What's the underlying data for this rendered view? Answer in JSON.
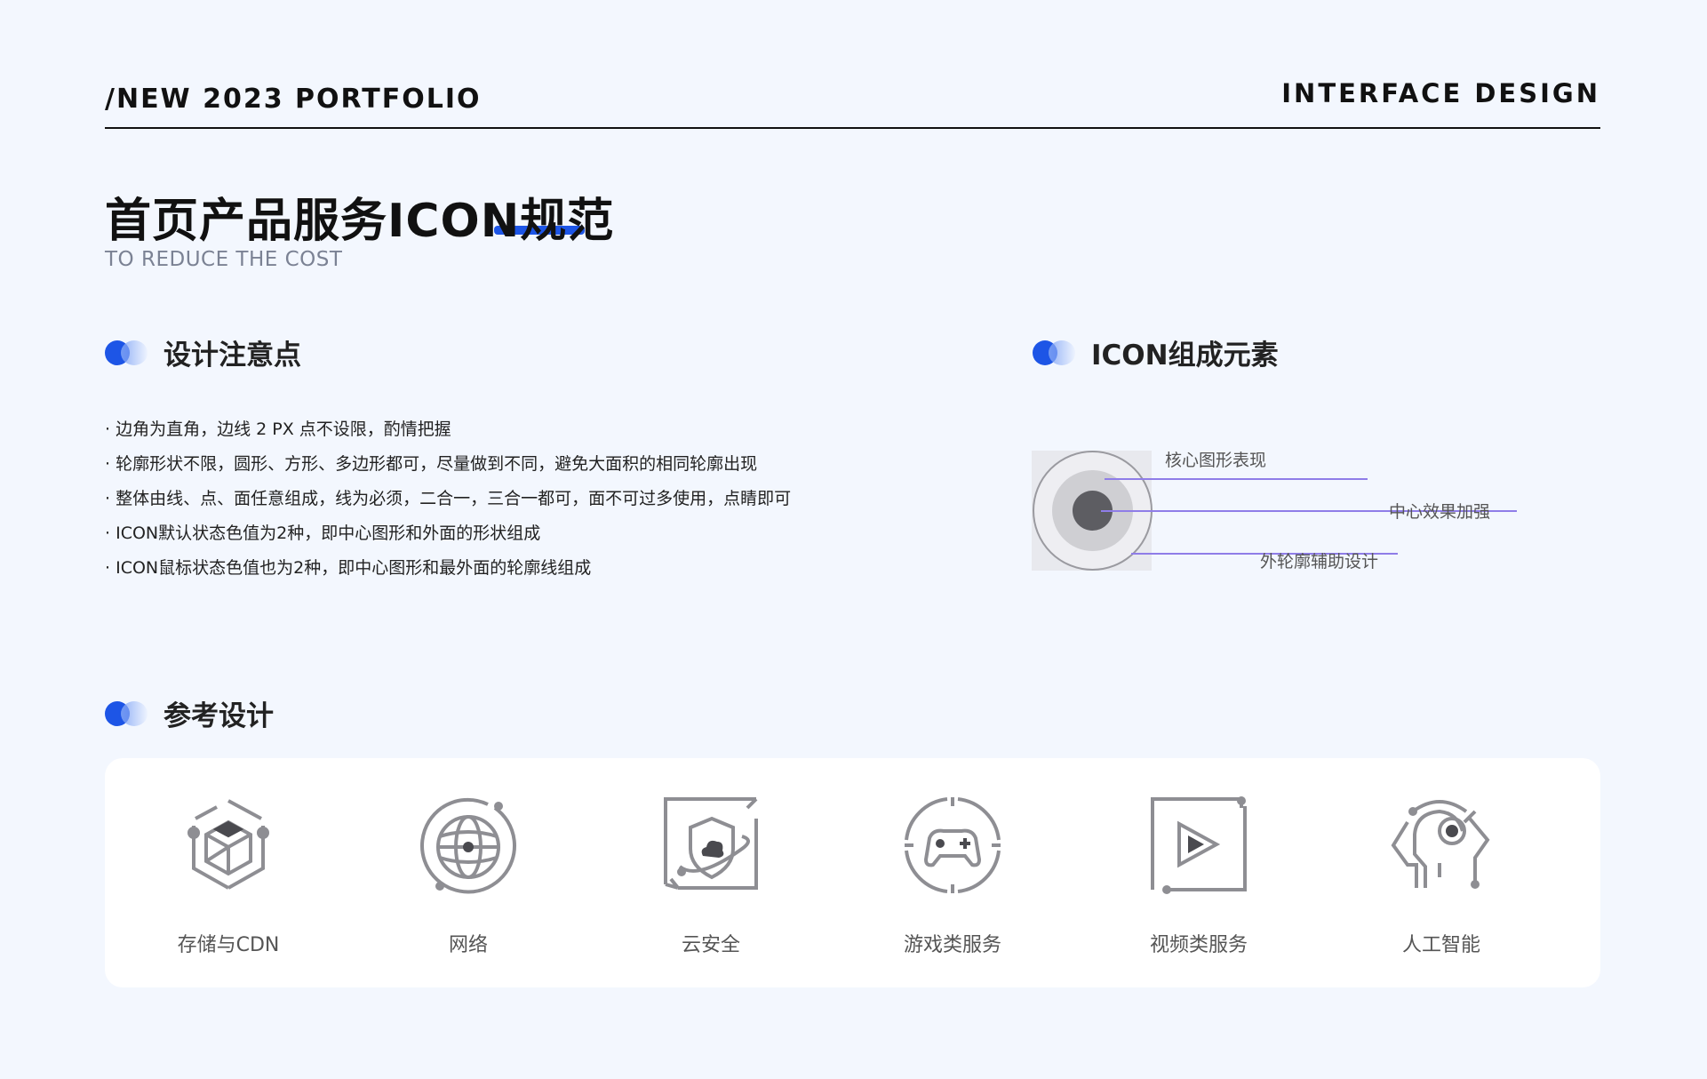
{
  "header": {
    "left": "/NEW 2023 PORTFOLIO",
    "right": "INTERFACE DESIGN"
  },
  "title": "首页产品服务ICON规范",
  "subtitle": "TO REDUCE THE COST",
  "sections": {
    "notes_title": "设计注意点",
    "composition_title": "ICON组成元素",
    "reference_title": "参考设计"
  },
  "notes": [
    "边角为直角，边线 2 PX  点不设限，酌情把握",
    "轮廓形状不限，圆形、方形、多边形都可，尽量做到不同，避免大面积的相同轮廓出现",
    "整体由线、点、面任意组成，线为必须，二合一，三合一都可，面不可过多使用，点睛即可",
    "ICON默认状态色值为2种，即中心图形和外面的形状组成",
    "ICON鼠标状态色值也为2种，即中心图形和最外面的轮廓线组成"
  ],
  "diagram_labels": {
    "core": "核心图形表现",
    "center": "中心效果加强",
    "outer": "外轮廓辅助设计"
  },
  "icons": [
    {
      "name": "cube-icon",
      "label": "存储与CDN"
    },
    {
      "name": "globe-icon",
      "label": "网络"
    },
    {
      "name": "cloud-shield-icon",
      "label": "云安全"
    },
    {
      "name": "gamepad-icon",
      "label": "游戏类服务"
    },
    {
      "name": "play-icon",
      "label": "视频类服务"
    },
    {
      "name": "ai-head-icon",
      "label": "人工智能"
    }
  ],
  "colors": {
    "accent": "#1d55e6",
    "icon_stroke": "#8e8e93",
    "diagram_line": "#8f7de8",
    "background": "#f3f7fe"
  }
}
